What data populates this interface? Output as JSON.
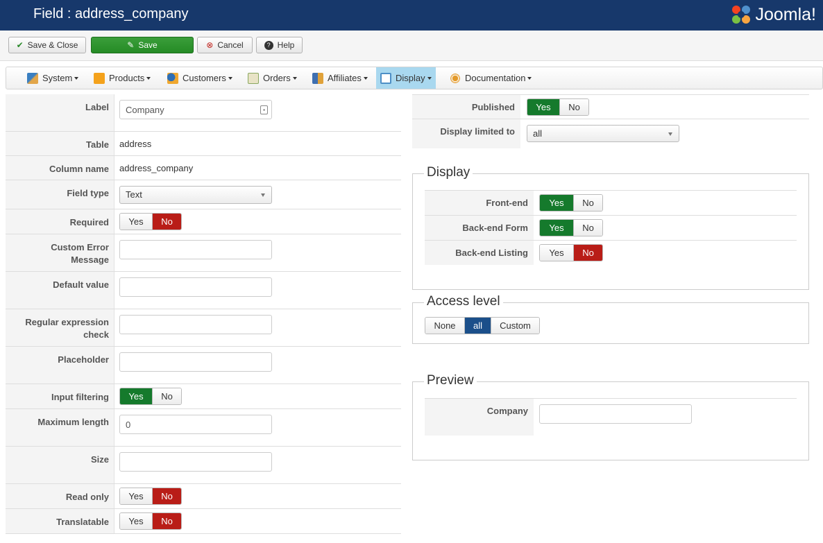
{
  "header": {
    "title": "Field : address_company",
    "logo_text": "Joomla!"
  },
  "toolbar": {
    "save_close": "Save & Close",
    "save": "Save",
    "cancel": "Cancel",
    "help": "Help"
  },
  "menu": [
    {
      "label": "System",
      "icon": "tools-icon",
      "color": "#3a7fc1"
    },
    {
      "label": "Products",
      "icon": "products-icon",
      "color": "#f4a21c"
    },
    {
      "label": "Customers",
      "icon": "customers-icon",
      "color": "#2f6fb5"
    },
    {
      "label": "Orders",
      "icon": "orders-icon",
      "color": "#8aa860"
    },
    {
      "label": "Affiliates",
      "icon": "affiliates-icon",
      "color": "#3f6fb0"
    },
    {
      "label": "Display",
      "icon": "display-icon",
      "color": "#4d8fc6"
    },
    {
      "label": "Documentation",
      "icon": "documentation-icon",
      "color": "#e39a2a"
    }
  ],
  "form": {
    "label": {
      "title": "Label",
      "value": "Company"
    },
    "table": {
      "title": "Table",
      "value": "address"
    },
    "column_name": {
      "title": "Column name",
      "value": "address_company"
    },
    "field_type": {
      "title": "Field type",
      "value": "Text"
    },
    "required": {
      "title": "Required",
      "yes": "Yes",
      "no": "No",
      "selected": "No"
    },
    "custom_error_line1": "Custom Error",
    "custom_error_line2": "Message",
    "default_value": {
      "title": "Default value",
      "value": ""
    },
    "regex_line1": "Regular expression",
    "regex_line2": "check",
    "placeholder": {
      "title": "Placeholder",
      "value": ""
    },
    "input_filtering": {
      "title": "Input filtering",
      "yes": "Yes",
      "no": "No",
      "selected": "Yes"
    },
    "maximum_length": {
      "title": "Maximum length",
      "value": "0"
    },
    "size": {
      "title": "Size",
      "value": ""
    },
    "read_only": {
      "title": "Read only",
      "yes": "Yes",
      "no": "No",
      "selected": "No"
    },
    "translatable": {
      "title": "Translatable",
      "yes": "Yes",
      "no": "No",
      "selected": "No"
    }
  },
  "right": {
    "published": {
      "title": "Published",
      "yes": "Yes",
      "no": "No",
      "selected": "Yes"
    },
    "display_limited": {
      "title": "Display limited to",
      "value": "all"
    },
    "display": {
      "legend": "Display",
      "frontend": {
        "title": "Front-end",
        "yes": "Yes",
        "no": "No",
        "selected": "Yes"
      },
      "backend_form": {
        "title": "Back-end Form",
        "yes": "Yes",
        "no": "No",
        "selected": "Yes"
      },
      "backend_listing": {
        "title": "Back-end Listing",
        "yes": "Yes",
        "no": "No",
        "selected": "No"
      }
    },
    "access": {
      "legend": "Access level",
      "none": "None",
      "all": "all",
      "custom": "Custom",
      "selected": "all"
    },
    "preview": {
      "legend": "Preview",
      "company_label": "Company",
      "company_value": ""
    }
  },
  "colors": {
    "header_bg": "#17386b",
    "save_green": "#258b25",
    "toggle_green": "#157a2c",
    "toggle_red": "#b91d17",
    "toggle_blue": "#1b4f8a",
    "menu_active": "#a9d8ef"
  }
}
